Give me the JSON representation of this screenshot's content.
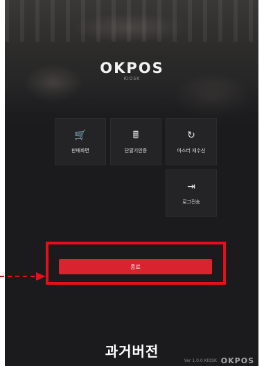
{
  "brand": {
    "logo": "OKPOS",
    "subtitle": "KIOSK"
  },
  "menu": {
    "tiles": [
      {
        "label": "판매화면",
        "icon": "shopping-cart-icon",
        "glyph": "🛒"
      },
      {
        "label": "단말기인증",
        "icon": "calculator-icon",
        "glyph": "🖩"
      },
      {
        "label": "마스터 재수신",
        "icon": "refresh-icon",
        "glyph": "↻"
      },
      {
        "label": "로그전송",
        "icon": "log-export-icon",
        "glyph": "⇥"
      }
    ]
  },
  "actions": {
    "exit_label": "종료"
  },
  "highlight": {
    "color": "#e3101c"
  },
  "caption": "과거버전",
  "footer": {
    "text": "Ver 1.0.0 KIOSK",
    "brand": "OKPOS"
  },
  "colors": {
    "background": "#1b1b1d",
    "tile": "#242426",
    "button": "#d9232f"
  }
}
